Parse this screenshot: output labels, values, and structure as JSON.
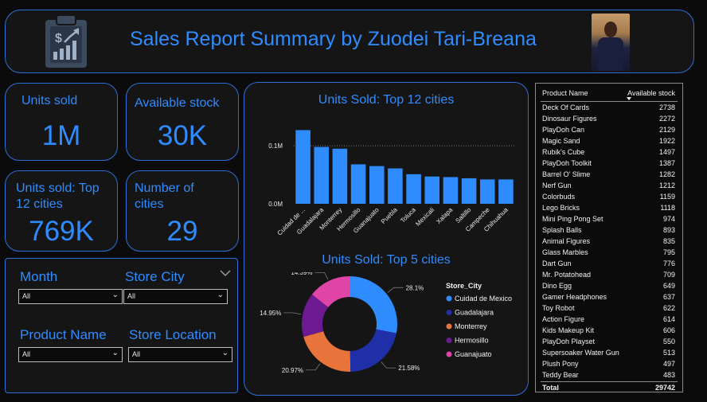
{
  "header": {
    "title": "Sales Report Summary by Zuodei Tari-Breana"
  },
  "kpis": {
    "units_sold": {
      "label": "Units sold",
      "value": "1M"
    },
    "available_stock": {
      "label": "Available stock",
      "value": "30K"
    },
    "units_top12": {
      "label": "Units sold: Top 12 cities",
      "value": "769K"
    },
    "num_cities": {
      "label": "Number of cities",
      "value": "29"
    }
  },
  "filters": {
    "month": {
      "label": "Month",
      "value": "All"
    },
    "store_city": {
      "label": "Store City",
      "value": "All"
    },
    "product_name": {
      "label": "Product Name",
      "value": "All"
    },
    "store_location": {
      "label": "Store Location",
      "value": "All"
    }
  },
  "chart_data": [
    {
      "type": "bar",
      "title": "Units Sold: Top 12 cities",
      "categories": [
        "Cuidad de ...",
        "Guadalajara",
        "Monterrey",
        "Hermosillo",
        "Guanajuato",
        "Puebla",
        "Toluca",
        "Mexicali",
        "Xalapa",
        "Saltillo",
        "Campeche",
        "Chihuahua"
      ],
      "values": [
        0.127,
        0.098,
        0.095,
        0.068,
        0.065,
        0.061,
        0.051,
        0.047,
        0.046,
        0.044,
        0.042,
        0.042
      ],
      "yticks": [
        "0.0M",
        "0.1M"
      ],
      "ylim": [
        0,
        0.14
      ],
      "color": "#2f8cff",
      "grid": true
    },
    {
      "type": "pie",
      "title": "Units Sold: Top 5 cities",
      "legend_title": "Store_City",
      "legend_position": "right",
      "labels": [
        "Cuidad de Mexico",
        "Guadalajara",
        "Monterrey",
        "Hermosillo",
        "Guanajuato"
      ],
      "values": [
        28.1,
        21.58,
        20.97,
        14.95,
        14.39
      ],
      "value_labels": [
        "28.1%",
        "21.58%",
        "20.97%",
        "14.95%",
        "14.39%"
      ],
      "colors": [
        "#2f8cff",
        "#1f2fa8",
        "#e8743b",
        "#6b1a8f",
        "#e044a7"
      ],
      "donut": true
    }
  ],
  "table": {
    "columns": [
      "Product Name",
      "Available stock"
    ],
    "rows": [
      [
        "Deck Of Cards",
        "2738"
      ],
      [
        "Dinosaur Figures",
        "2272"
      ],
      [
        "PlayDoh Can",
        "2129"
      ],
      [
        "Magic Sand",
        "1922"
      ],
      [
        "Rubik's Cube",
        "1497"
      ],
      [
        "PlayDoh Toolkit",
        "1387"
      ],
      [
        "Barrel O' Slime",
        "1282"
      ],
      [
        "Nerf Gun",
        "1212"
      ],
      [
        "Colorbuds",
        "1159"
      ],
      [
        "Lego Bricks",
        "1118"
      ],
      [
        "Mini Ping Pong Set",
        "974"
      ],
      [
        "Splash Balls",
        "893"
      ],
      [
        "Animal Figures",
        "835"
      ],
      [
        "Glass Marbles",
        "795"
      ],
      [
        "Dart Gun",
        "776"
      ],
      [
        "Mr. Potatohead",
        "709"
      ],
      [
        "Dino Egg",
        "649"
      ],
      [
        "Gamer Headphones",
        "637"
      ],
      [
        "Toy Robot",
        "622"
      ],
      [
        "Action Figure",
        "614"
      ],
      [
        "Kids Makeup Kit",
        "606"
      ],
      [
        "PlayDoh Playset",
        "550"
      ],
      [
        "Supersoaker Water Gun",
        "513"
      ],
      [
        "Plush Pony",
        "497"
      ],
      [
        "Teddy Bear",
        "483"
      ]
    ],
    "total_label": "Total",
    "total_value": "29742"
  },
  "icons": {
    "logo": "sales-report-clipboard-icon",
    "select": "chevron-down-icon"
  }
}
